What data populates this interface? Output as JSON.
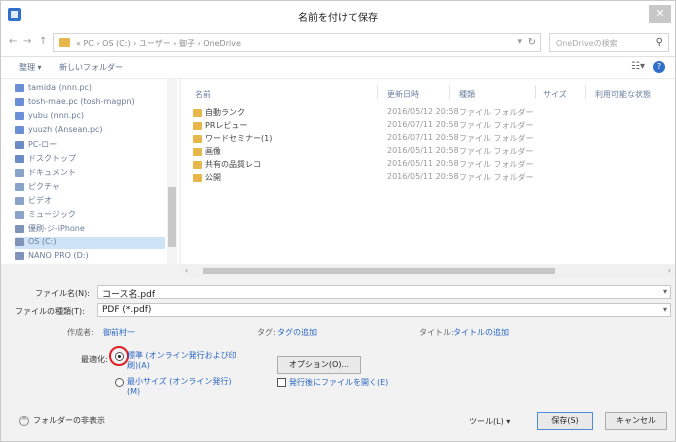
{
  "window": {
    "title": "名前を付けて保存",
    "close_glyph": "✕"
  },
  "addressbar": {
    "back_glyph": "←",
    "forward_glyph": "→",
    "up_glyph": "↑",
    "path": "« PC › OS (C:) › ユーザー › 御子 › OneDrive",
    "search_placeholder": "OneDriveの検索"
  },
  "toolbar": {
    "organize_label": "整理 ▾",
    "new_folder_label": "新しいフォルダー"
  },
  "nav_pane": {
    "items": [
      {
        "label": "tamida (nnn.pc)",
        "color": "#6b8fd6"
      },
      {
        "label": "tosh-mae.pc (tosh-magpn)",
        "color": "#6b8fd6"
      },
      {
        "label": "yubu (nnn.pc)",
        "color": "#6b8fd6"
      },
      {
        "label": "yuuzh (Ansean.pc)",
        "color": "#6b8fd6"
      },
      {
        "label": "PC-ロー",
        "color": "#6c8bc4"
      },
      {
        "label": "ドスクトップ",
        "color": "#6c8bc4"
      },
      {
        "label": "ドキュメント",
        "color": "#8aa3c8"
      },
      {
        "label": "ピクチャ",
        "color": "#8aa3c8"
      },
      {
        "label": "ビデオ",
        "color": "#8aa3c8"
      },
      {
        "label": "ミュージック",
        "color": "#8aa3c8"
      },
      {
        "label": "優刷-ジ-iPhone",
        "color": "#7f93b8"
      },
      {
        "label": "OS (C:)",
        "color": "#7f93b8",
        "selected": true
      },
      {
        "label": "NANO PRO (D:)",
        "color": "#7f93b8"
      }
    ]
  },
  "filelist": {
    "columns": {
      "name": "名前",
      "date": "更新日時",
      "type": "種類",
      "size": "サイズ",
      "status": "利用可能な状態"
    },
    "rows": [
      {
        "name": "自動ランク",
        "date": "2016/05/12 20:58",
        "type": "ファイル フォルダー"
      },
      {
        "name": "PRレビュー",
        "date": "2016/07/11 20:58",
        "type": "ファイル フォルダー"
      },
      {
        "name": "ワードセミナー(1)",
        "date": "2016/07/11 20:58",
        "type": "ファイル フォルダー"
      },
      {
        "name": "画像",
        "date": "2016/05/11 20:58",
        "type": "ファイル フォルダー"
      },
      {
        "name": "共有の品質レコ",
        "date": "2016/05/11 20:58",
        "type": "ファイル フォルダー"
      },
      {
        "name": "公開",
        "date": "2016/05/11 20:58",
        "type": "ファイル フォルダー"
      }
    ]
  },
  "form": {
    "filename_label": "ファイル名(N):",
    "filename_value": "コース名.pdf",
    "filetype_label": "ファイルの種類(T):",
    "filetype_value": "PDF (*.pdf)",
    "author_label": "作成者:",
    "author_value": "御前村一",
    "tags_label": "タグ:",
    "tags_value": "タグの追加",
    "title_label": "タイトル:",
    "title_value": "タイトルの追加",
    "optimize_label": "最適化:",
    "radio_standard": "標準 (オンライン発行および印刷)(A)",
    "radio_minimum": "最小サイズ (オンライン発行)(M)",
    "options_button": "オプション(O)...",
    "open_after_label": "発行後にファイルを開く(E)",
    "hide_folders": "フォルダーの非表示",
    "tools_label": "ツール(L)  ▾",
    "save_button": "保存(S)",
    "cancel_button": "キャンセル",
    "chevron_glyph": "^",
    "dropdown_glyph": "▾"
  }
}
